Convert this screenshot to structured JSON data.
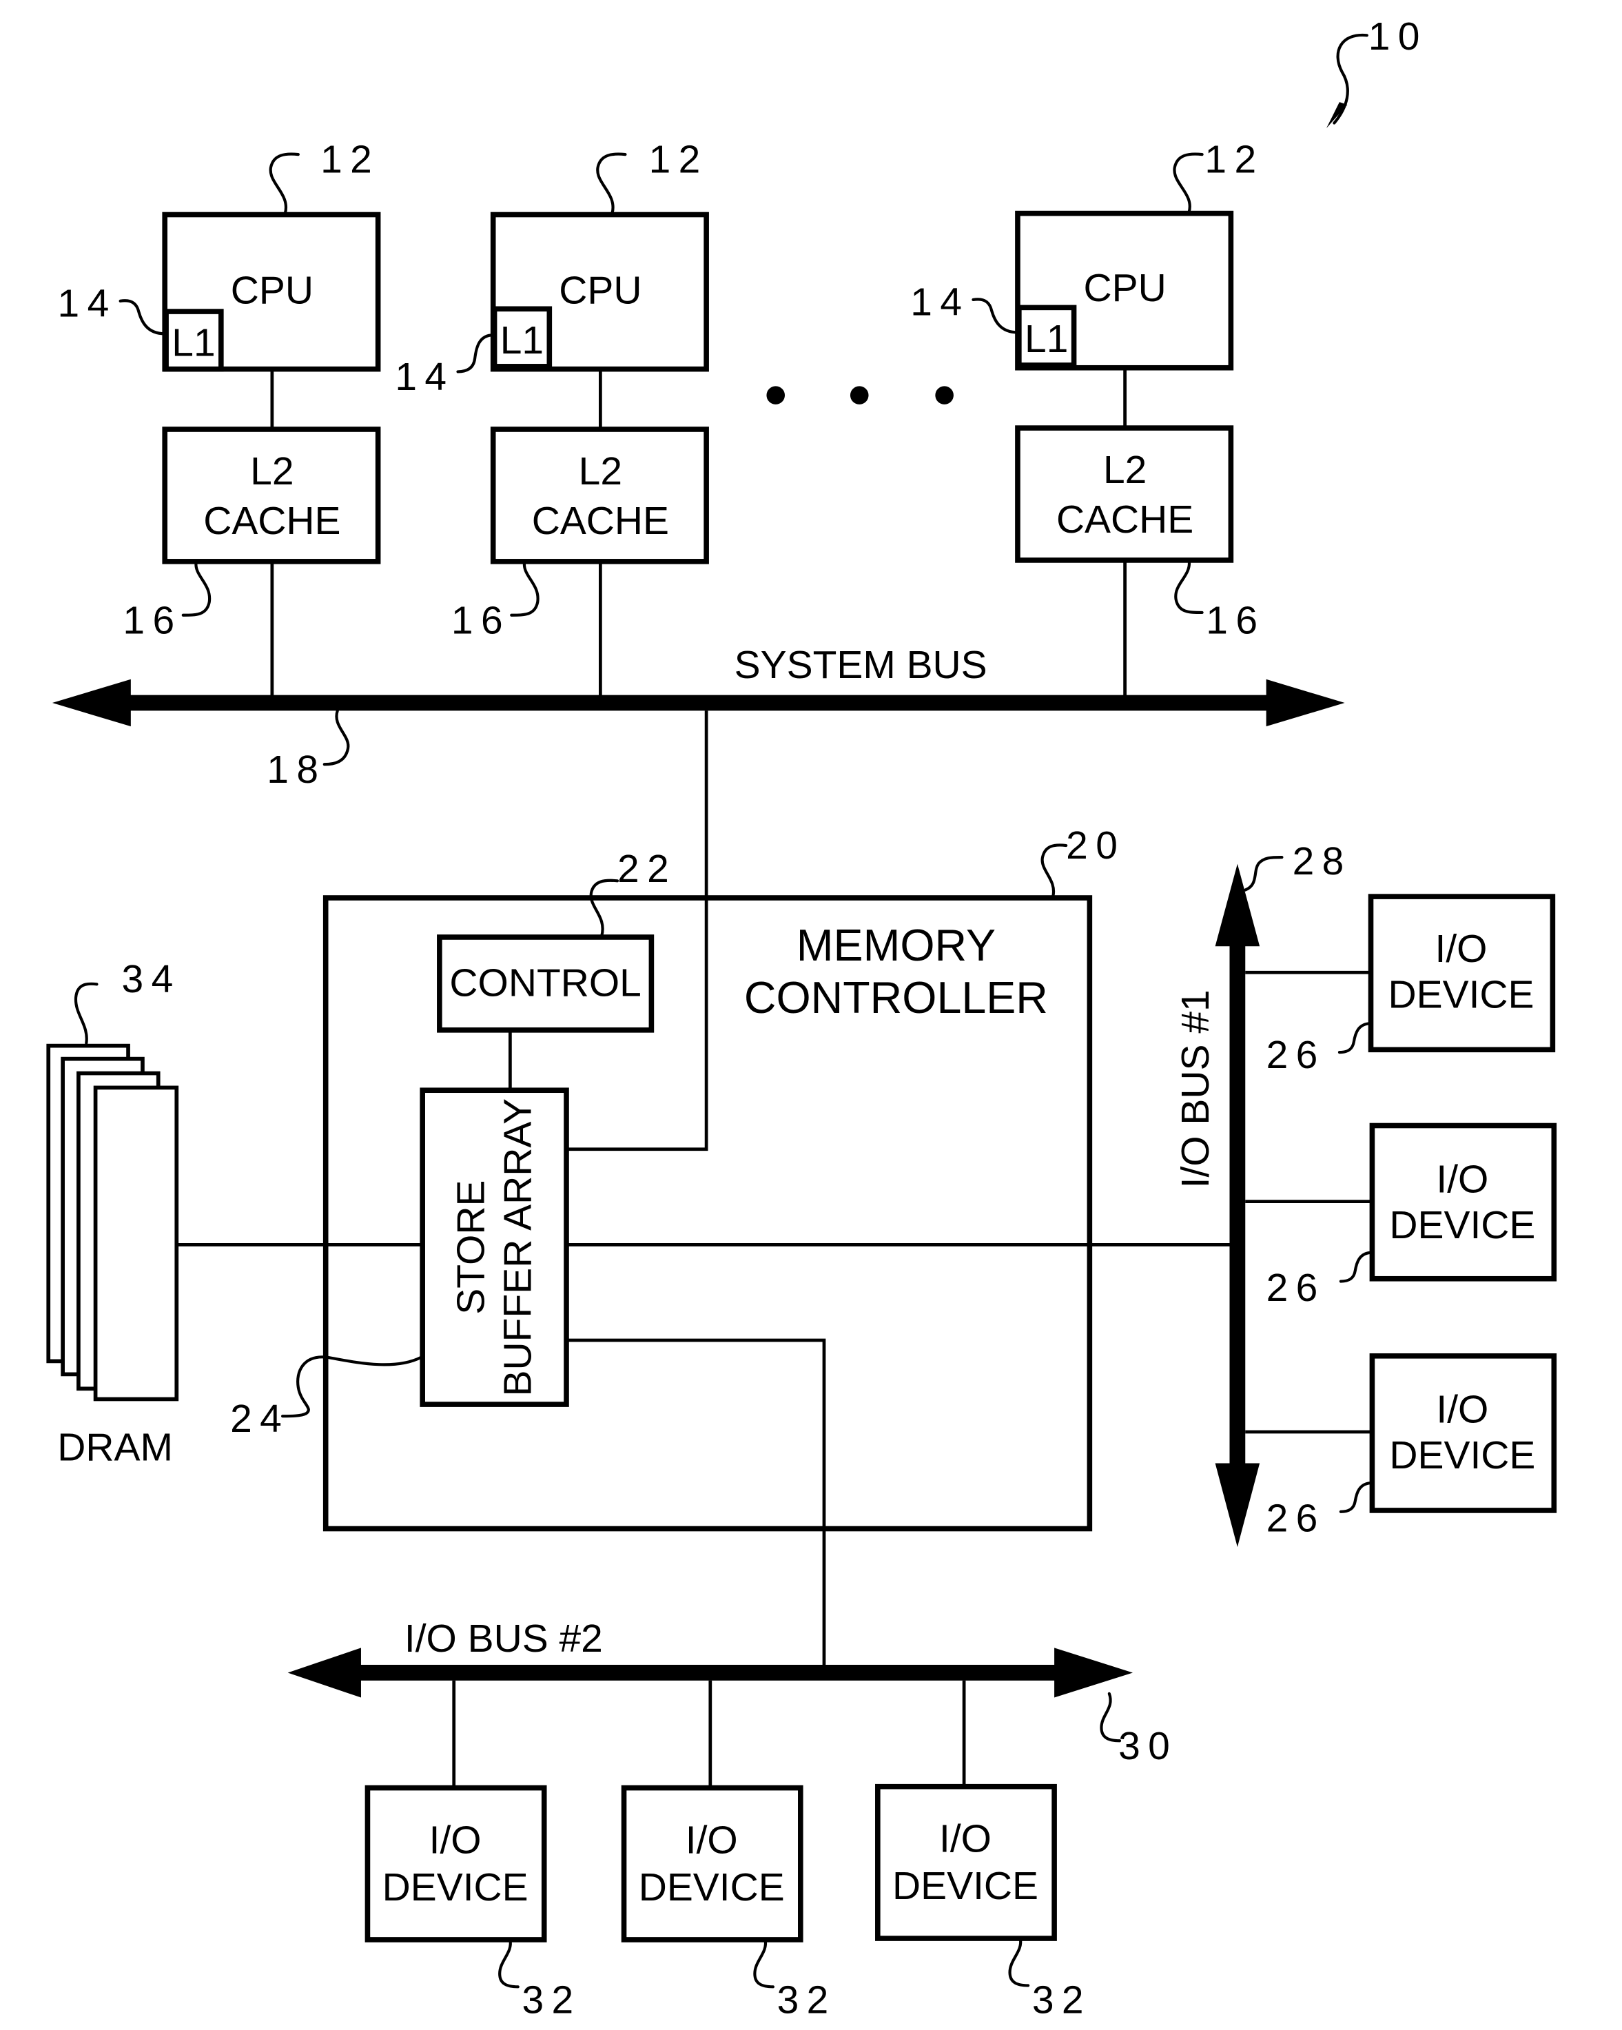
{
  "figure": {
    "ref": "10",
    "cpus": [
      {
        "label": "CPU",
        "l1_label": "L1",
        "l2_line1": "L2",
        "l2_line2": "CACHE",
        "cpu_ref": "12",
        "l1_ref": "14",
        "l2_ref": "16"
      },
      {
        "label": "CPU",
        "l1_label": "L1",
        "l2_line1": "L2",
        "l2_line2": "CACHE",
        "cpu_ref": "12",
        "l1_ref": "14",
        "l2_ref": "16"
      },
      {
        "label": "CPU",
        "l1_label": "L1",
        "l2_line1": "L2",
        "l2_line2": "CACHE",
        "cpu_ref": "12",
        "l1_ref": "14",
        "l2_ref": "16"
      }
    ],
    "system_bus": {
      "label": "SYSTEM BUS",
      "ref": "18"
    },
    "memory_controller": {
      "line1": "MEMORY",
      "line2": "CONTROLLER",
      "ref": "20"
    },
    "control": {
      "label": "CONTROL",
      "ref": "22"
    },
    "store_buffer": {
      "line1": "STORE",
      "line2": "BUFFER ARRAY",
      "ref": "24"
    },
    "dram": {
      "label": "DRAM",
      "ref": "34"
    },
    "io_bus_1": {
      "label": "I/O BUS #1",
      "ref": "28"
    },
    "io_bus_2": {
      "label": "I/O BUS #2",
      "ref": "30"
    },
    "io_devices_bus1": [
      {
        "line1": "I/O",
        "line2": "DEVICE",
        "ref": "26"
      },
      {
        "line1": "I/O",
        "line2": "DEVICE",
        "ref": "26"
      },
      {
        "line1": "I/O",
        "line2": "DEVICE",
        "ref": "26"
      }
    ],
    "io_devices_bus2": [
      {
        "line1": "I/O",
        "line2": "DEVICE",
        "ref": "32"
      },
      {
        "line1": "I/O",
        "line2": "DEVICE",
        "ref": "32"
      },
      {
        "line1": "I/O",
        "line2": "DEVICE",
        "ref": "32"
      }
    ]
  }
}
